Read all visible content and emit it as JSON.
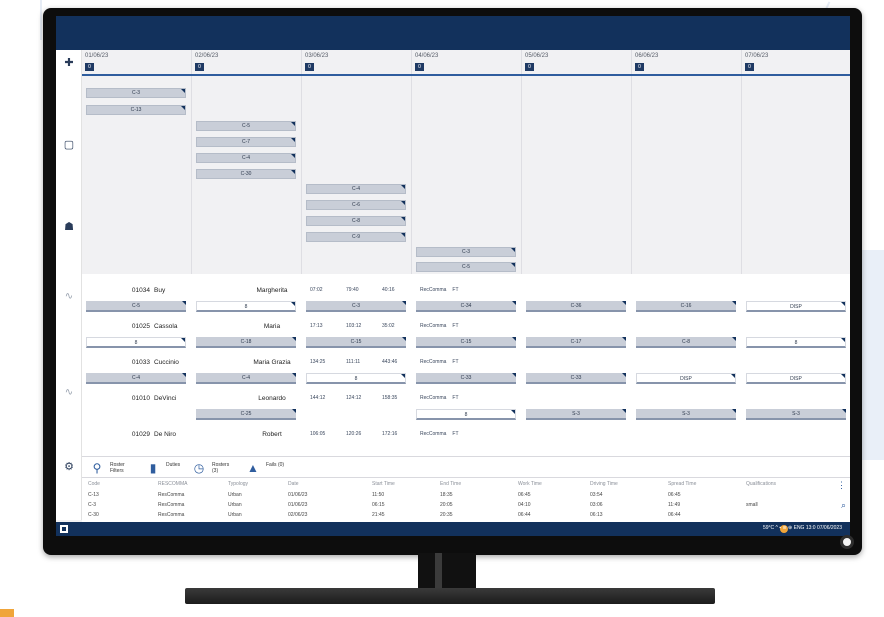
{
  "days": [
    {
      "date": "01/06/23",
      "badge": "0",
      "chips": [
        "C-3",
        "C-13"
      ]
    },
    {
      "date": "02/06/23",
      "badge": "0",
      "chips": [
        "C-5",
        "C-7",
        "C-4",
        "C-30"
      ]
    },
    {
      "date": "03/06/23",
      "badge": "0",
      "chips": [
        "C-4",
        "C-6",
        "C-8",
        "C-9"
      ]
    },
    {
      "date": "04/06/23",
      "badge": "0",
      "chips": [
        "C-3",
        "C-5"
      ]
    },
    {
      "date": "05/06/23",
      "badge": "0",
      "chips": []
    },
    {
      "date": "06/06/23",
      "badge": "0",
      "chips": []
    },
    {
      "date": "07/06/23",
      "badge": "0",
      "chips": []
    }
  ],
  "crew": [
    {
      "id": "01034",
      "surname": "Buy",
      "name": "Margherita",
      "m1": "07:02",
      "m2": "79:40",
      "m3": "40:16",
      "tag": "RecComma",
      "tag2": "FT",
      "cells": [
        "C-5",
        "8",
        "C-3",
        "C-34",
        "C-36",
        "C-16",
        "DISP"
      ]
    },
    {
      "id": "01025",
      "surname": "Cassola",
      "name": "Maria",
      "m1": "17:13",
      "m2": "103:12",
      "m3": "35:02",
      "tag": "RecComma",
      "tag2": "FT",
      "cells": [
        "8",
        "C-18",
        "C-15",
        "C-15",
        "C-17",
        "C-8",
        "8"
      ]
    },
    {
      "id": "01033",
      "surname": "Cuccinio",
      "name": "Maria Grazia",
      "m1": "134:25",
      "m2": "111:11",
      "m3": "443:46",
      "tag": "RecComma",
      "tag2": "FT",
      "cells": [
        "C-4",
        "C-4",
        "8",
        "C-33",
        "C-33",
        "DISP",
        "DISP"
      ]
    },
    {
      "id": "01010",
      "surname": "DeVinci",
      "name": "Leonardo",
      "m1": "144:12",
      "m2": "124:12",
      "m3": "158:35",
      "tag": "RecComma",
      "tag2": "FT",
      "cells": [
        "",
        "C-25",
        "",
        "8",
        "S-3",
        "S-3",
        "S-3"
      ]
    },
    {
      "id": "01029",
      "surname": "De Niro",
      "name": "Robert",
      "m1": "106:05",
      "m2": "120:26",
      "m3": "172:16",
      "tag": "RecComma",
      "tag2": "FT",
      "cells": []
    }
  ],
  "tabs": [
    {
      "icon": "filter-icon",
      "l1": "Roster",
      "l2": "Filters"
    },
    {
      "icon": "book-icon",
      "l1": "Duties",
      "l2": ""
    },
    {
      "icon": "clock-icon",
      "l1": "Rosters",
      "l2": "(3)"
    },
    {
      "icon": "warning-icon",
      "l1": "Fails (0)",
      "l2": ""
    }
  ],
  "table": {
    "headers": [
      "Code",
      "RESCOMMA",
      "Typology",
      "Date",
      "Start Time",
      "End Time",
      "Work Time",
      "Driving Time",
      "Spread Time",
      "Qualifications"
    ],
    "rows": [
      [
        "C-13",
        "ResComma",
        "Urban",
        "01/06/23",
        "11:50",
        "18:35",
        "06:45",
        "03:54",
        "06:45",
        ""
      ],
      [
        "C-3",
        "ResComma",
        "Urban",
        "01/06/23",
        "06:15",
        "20:05",
        "04:10",
        "03:06",
        "11:49",
        "small"
      ],
      [
        "C-30",
        "ResComma",
        "Urban",
        "02/06/23",
        "21:45",
        "20:35",
        "06:44",
        "06:13",
        "06:44",
        ""
      ]
    ]
  },
  "taskbar": {
    "tray": "59°C  ^  ▪  ≋  ⊕  ENG",
    "time": "13:0",
    "date": "07/06/2023"
  },
  "colors": {
    "header": "#12315c",
    "accent": "#2f5d9e",
    "chip": "#c9ced8"
  }
}
